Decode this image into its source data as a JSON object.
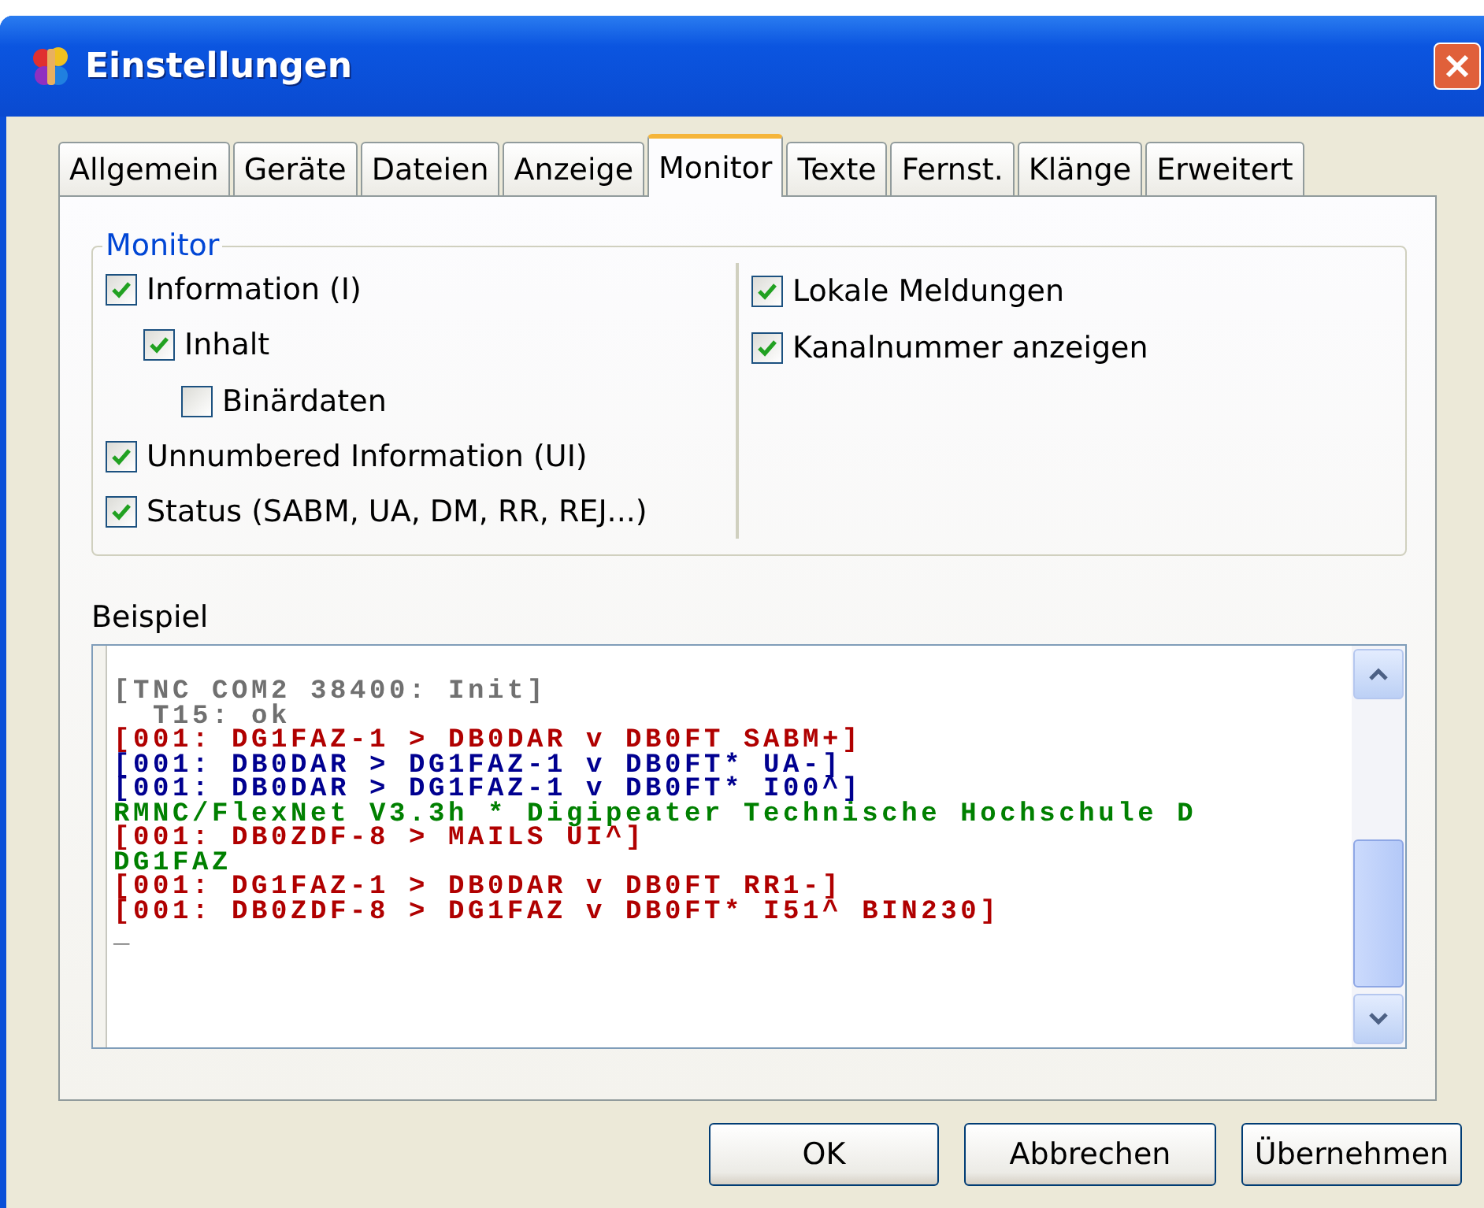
{
  "window": {
    "title": "Einstellungen"
  },
  "tabs": [
    {
      "label": "Allgemein",
      "selected": false
    },
    {
      "label": "Geräte",
      "selected": false
    },
    {
      "label": "Dateien",
      "selected": false
    },
    {
      "label": "Anzeige",
      "selected": false
    },
    {
      "label": "Monitor",
      "selected": true
    },
    {
      "label": "Texte",
      "selected": false
    },
    {
      "label": "Fernst.",
      "selected": false
    },
    {
      "label": "Klänge",
      "selected": false
    },
    {
      "label": "Erweitert",
      "selected": false
    }
  ],
  "group": {
    "title": "Monitor",
    "left": [
      {
        "label": "Information (I)",
        "checked": true,
        "children": [
          {
            "label": "Inhalt",
            "checked": true,
            "children": [
              {
                "label": "Binärdaten",
                "checked": false
              }
            ]
          }
        ]
      },
      {
        "label": "Unnumbered Information (UI)",
        "checked": true
      },
      {
        "label": "Status (SABM, UA, DM, RR, REJ...)",
        "checked": true
      }
    ],
    "right": [
      {
        "label": "Lokale Meldungen",
        "checked": true
      },
      {
        "label": "Kanalnummer anzeigen",
        "checked": true
      }
    ]
  },
  "example": {
    "label": "Beispiel",
    "lines": [
      {
        "text": "[TNC COM2 38400: Init]",
        "color": "#707070"
      },
      {
        "text": "  T15: ok",
        "color": "#707070"
      },
      {
        "text": "[001: DG1FAZ-1 > DB0DAR v DB0FT SABM+]",
        "color": "#b00000"
      },
      {
        "text": "[001: DB0DAR > DG1FAZ-1 v DB0FT* UA-]",
        "color": "#000090"
      },
      {
        "text": "[001: DB0DAR > DG1FAZ-1 v DB0FT* I00^]",
        "color": "#000090"
      },
      {
        "text": "RMNC/FlexNet V3.3h * Digipeater Technische Hochschule D",
        "color": "#008000"
      },
      {
        "text": "[001: DB0ZDF-8 > MAILS UI^]",
        "color": "#b00000"
      },
      {
        "text": "DG1FAZ",
        "color": "#008000"
      },
      {
        "text": "[001: DG1FAZ-1 > DB0DAR v DB0FT RR1-]",
        "color": "#b00000"
      },
      {
        "text": "[001: DB0ZDF-8 > DG1FAZ v DB0FT* I51^ BIN230]",
        "color": "#b00000"
      },
      {
        "text": "_",
        "color": "#707070"
      }
    ]
  },
  "buttons": [
    {
      "label": "OK"
    },
    {
      "label": "Abbrechen"
    },
    {
      "label": "Übernehmen"
    }
  ]
}
